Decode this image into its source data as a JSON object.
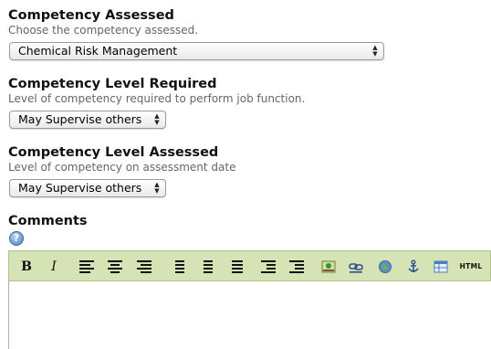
{
  "competency_assessed": {
    "label": "Competency Assessed",
    "hint": "Choose the competency assessed.",
    "selected": "Chemical Risk Management"
  },
  "level_required": {
    "label": "Competency Level Required",
    "hint": "Level of competency required to perform job function.",
    "selected": "May Supervise others"
  },
  "level_assessed": {
    "label": "Competency Level Assessed",
    "hint": "Level of competency on assessment date",
    "selected": "May Supervise others"
  },
  "comments": {
    "label": "Comments",
    "help_glyph": "?"
  },
  "toolbar": {
    "bold": "B",
    "italic": "I",
    "html": "HTML",
    "background": "#d6e3b4",
    "icons": [
      "bold-icon",
      "italic-icon",
      "align-left-icon",
      "align-center-icon",
      "align-right-icon",
      "ordered-list-icon",
      "unordered-list-icon",
      "outdent-icon",
      "indent-icon",
      "indent-more-icon",
      "image-icon",
      "link-icon",
      "globe-icon",
      "anchor-icon",
      "table-icon",
      "html-source-icon"
    ]
  },
  "colors": {
    "hint_text": "#666666",
    "help_icon": "#4a7fbf"
  }
}
